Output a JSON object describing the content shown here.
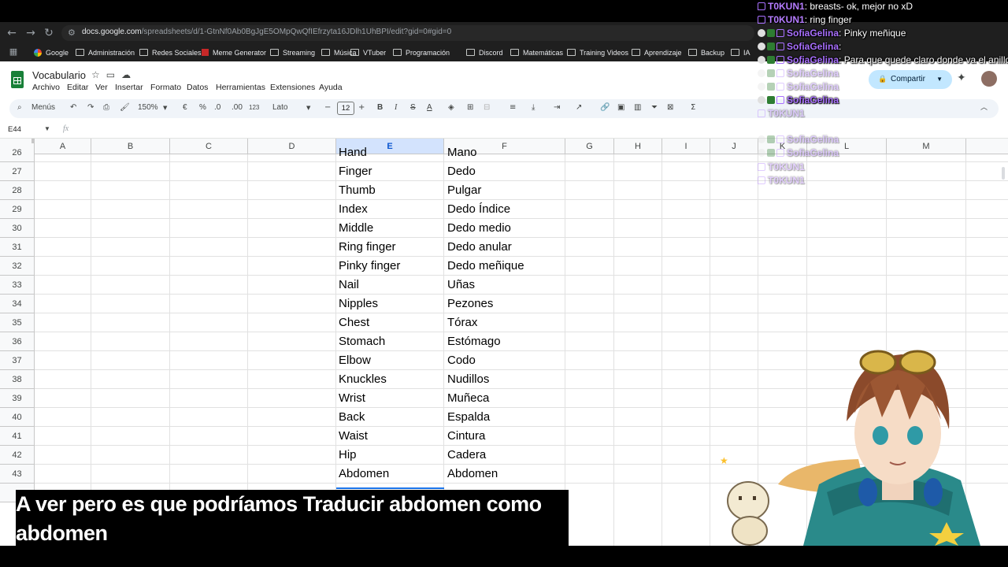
{
  "browser": {
    "url_domain": "docs.google.com",
    "url_path": "/spreadsheets/d/1-GtnNf0Ab0BgJgE5OMpQwQfIEfrzyta16JDlh1UhBPI/edit?gid=0#gid=0",
    "bookmarks": [
      "Google",
      "Administración",
      "Redes Sociales",
      "Meme Generator",
      "Streaming",
      "Música",
      "VTuber",
      "Programación",
      "Discord",
      "Matemáticas",
      "Training Videos",
      "Aprendizaje",
      "Backup",
      "IA"
    ]
  },
  "sheets": {
    "doc_title": "Vocabulario",
    "menu": [
      "Archivo",
      "Editar",
      "Ver",
      "Insertar",
      "Formato",
      "Datos",
      "Herramientas",
      "Extensiones",
      "Ayuda"
    ],
    "share_label": "Compartir",
    "toolbar": {
      "menus_label": "Menús",
      "zoom": "150%",
      "currency": "€",
      "percent": "%",
      "dec_less": ".0",
      "dec_more": ".00",
      "number_format": "123",
      "font": "Lato",
      "font_size": "12"
    },
    "name_box": "E44",
    "fx_label": "fx",
    "columns": [
      "A",
      "B",
      "C",
      "D",
      "E",
      "F",
      "G",
      "H",
      "I",
      "J",
      "K",
      "L",
      "M"
    ],
    "selected_column": "E",
    "rows": [
      {
        "n": "26",
        "e": "Hand",
        "f": "Mano"
      },
      {
        "n": "27",
        "e": "Finger",
        "f": "Dedo"
      },
      {
        "n": "28",
        "e": "Thumb",
        "f": "Pulgar"
      },
      {
        "n": "29",
        "e": "Index",
        "f": "Dedo Índice"
      },
      {
        "n": "30",
        "e": "Middle",
        "f": "Dedo medio"
      },
      {
        "n": "31",
        "e": "Ring finger",
        "f": "Dedo anular"
      },
      {
        "n": "32",
        "e": "Pinky finger",
        "f": "Dedo meñique"
      },
      {
        "n": "33",
        "e": "Nail",
        "f": "Uñas"
      },
      {
        "n": "34",
        "e": "Nipples",
        "f": "Pezones"
      },
      {
        "n": "35",
        "e": "Chest",
        "f": "Tórax"
      },
      {
        "n": "36",
        "e": "Stomach",
        "f": "Estómago"
      },
      {
        "n": "37",
        "e": "Elbow",
        "f": "Codo"
      },
      {
        "n": "38",
        "e": "Knuckles",
        "f": "Nudillos"
      },
      {
        "n": "39",
        "e": "Wrist",
        "f": "Muñeca"
      },
      {
        "n": "40",
        "e": "Back",
        "f": "Espalda"
      },
      {
        "n": "41",
        "e": "Waist",
        "f": "Cintura"
      },
      {
        "n": "42",
        "e": "Hip",
        "f": "Cadera"
      },
      {
        "n": "43",
        "e": "Abdomen",
        "f": "Abdomen"
      }
    ]
  },
  "chat": [
    {
      "user": "T0KUN1",
      "text": ": breasts- ok, mejor no xD"
    },
    {
      "user": "T0KUN1",
      "text": ": ring finger"
    },
    {
      "user": "SofiaGelina",
      "text": ": Pinky meñique"
    },
    {
      "user": "SofiaGelina",
      "text": ":"
    },
    {
      "user": "SofiaGelina",
      "text": ": Para que quede claro donde va el anillo"
    },
    {
      "user": "SofiaGelina",
      "text": ""
    },
    {
      "user": "SofiaGelina",
      "text": ""
    },
    {
      "user": "SofiaGelina",
      "text": ""
    },
    {
      "user": "T0KUN1",
      "text": ""
    },
    {
      "user": "SofiaGelina",
      "text": ""
    },
    {
      "user": "SofiaGelina",
      "text": ""
    },
    {
      "user": "T0KUN1",
      "text": ""
    },
    {
      "user": "T0KUN1",
      "text": ""
    }
  ],
  "subtitle": "A ver pero es que podríamos Traducir abdomen como abdomen",
  "colors": {
    "accent": "#0b57d0",
    "selected_header": "#d3e3fd",
    "share_bg": "#c2e7ff",
    "twitch": "#a970ff"
  }
}
